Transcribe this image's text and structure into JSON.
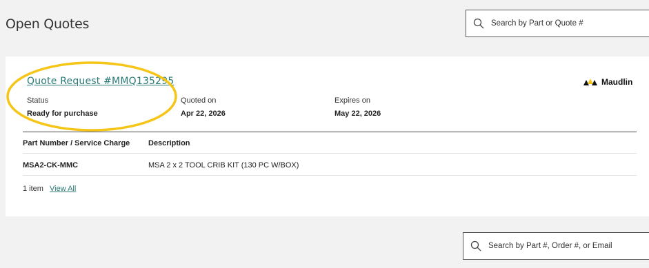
{
  "header": {
    "title": "Open Quotes",
    "search_placeholder": "Search by Part or Quote #"
  },
  "quote": {
    "link_label": "Quote Request #MMQ135295",
    "brand_name": "Maudlin",
    "status_label": "Status",
    "status_value": "Ready for purchase",
    "quoted_label": "Quoted on",
    "quoted_value": "Apr 22, 2026",
    "expires_label": "Expires on",
    "expires_value": "May 22, 2026",
    "table": {
      "columns": [
        "Part Number / Service Charge",
        "Description"
      ],
      "rows": [
        [
          "MSA2-CK-MMC",
          "MSA 2 x 2 TOOL CRIB KIT (130 PC W/BOX)"
        ]
      ]
    },
    "items_count": "1 item",
    "view_all_label": "View All"
  },
  "footer": {
    "search_placeholder": "Search by Part #, Order #, or Email"
  },
  "colors": {
    "link": "#2a7a78",
    "highlight": "#f5c518",
    "band": "#f2f2f2"
  },
  "icons": {
    "search": "search-icon",
    "brand": "maudlin-logo-icon"
  }
}
